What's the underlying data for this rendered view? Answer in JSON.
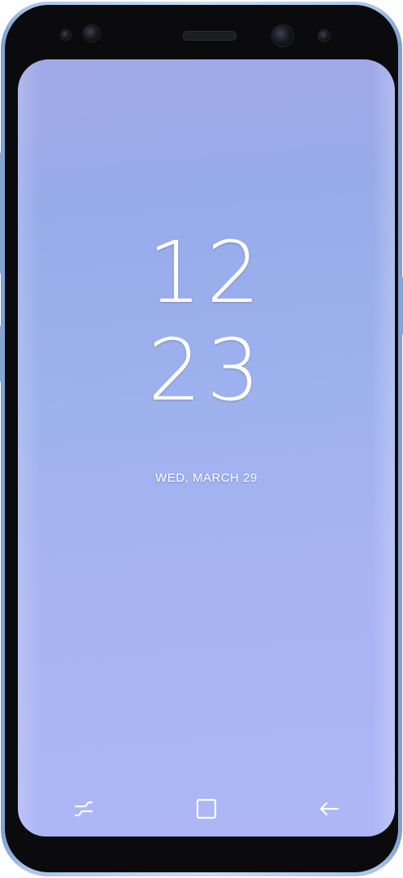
{
  "lockscreen": {
    "clock_hours": "12",
    "clock_minutes": "23",
    "date": "WED, MARCH 29"
  },
  "navbar": {
    "recents_icon": "recent-apps-icon",
    "home_icon": "home-square-icon",
    "back_icon": "back-arrow-icon"
  },
  "colors": {
    "frame_accent": "#a9c4ea",
    "wallpaper_top": "#97aaea",
    "wallpaper_bottom": "#aeb6f6",
    "text": "#ffffff"
  }
}
